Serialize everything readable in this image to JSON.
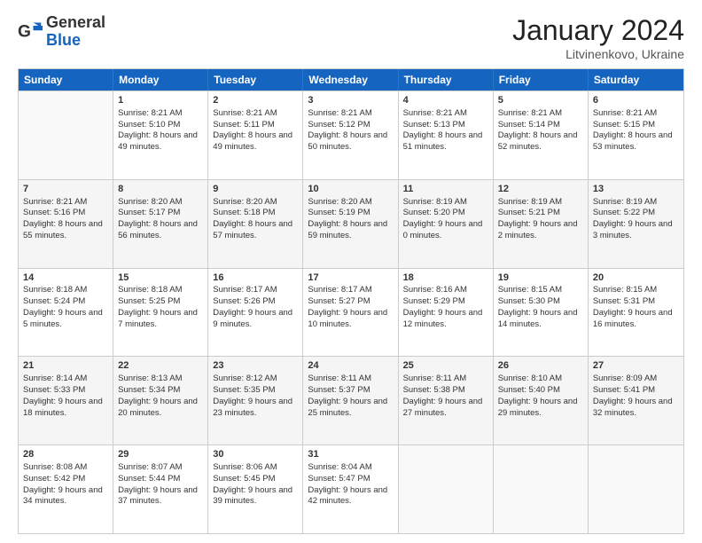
{
  "header": {
    "logo_general": "General",
    "logo_blue": "Blue",
    "month_title": "January 2024",
    "location": "Litvinenkovo, Ukraine"
  },
  "weekdays": [
    "Sunday",
    "Monday",
    "Tuesday",
    "Wednesday",
    "Thursday",
    "Friday",
    "Saturday"
  ],
  "rows": [
    [
      {
        "day": "",
        "sunrise": "",
        "sunset": "",
        "daylight": ""
      },
      {
        "day": "1",
        "sunrise": "Sunrise: 8:21 AM",
        "sunset": "Sunset: 5:10 PM",
        "daylight": "Daylight: 8 hours and 49 minutes."
      },
      {
        "day": "2",
        "sunrise": "Sunrise: 8:21 AM",
        "sunset": "Sunset: 5:11 PM",
        "daylight": "Daylight: 8 hours and 49 minutes."
      },
      {
        "day": "3",
        "sunrise": "Sunrise: 8:21 AM",
        "sunset": "Sunset: 5:12 PM",
        "daylight": "Daylight: 8 hours and 50 minutes."
      },
      {
        "day": "4",
        "sunrise": "Sunrise: 8:21 AM",
        "sunset": "Sunset: 5:13 PM",
        "daylight": "Daylight: 8 hours and 51 minutes."
      },
      {
        "day": "5",
        "sunrise": "Sunrise: 8:21 AM",
        "sunset": "Sunset: 5:14 PM",
        "daylight": "Daylight: 8 hours and 52 minutes."
      },
      {
        "day": "6",
        "sunrise": "Sunrise: 8:21 AM",
        "sunset": "Sunset: 5:15 PM",
        "daylight": "Daylight: 8 hours and 53 minutes."
      }
    ],
    [
      {
        "day": "7",
        "sunrise": "Sunrise: 8:21 AM",
        "sunset": "Sunset: 5:16 PM",
        "daylight": "Daylight: 8 hours and 55 minutes."
      },
      {
        "day": "8",
        "sunrise": "Sunrise: 8:20 AM",
        "sunset": "Sunset: 5:17 PM",
        "daylight": "Daylight: 8 hours and 56 minutes."
      },
      {
        "day": "9",
        "sunrise": "Sunrise: 8:20 AM",
        "sunset": "Sunset: 5:18 PM",
        "daylight": "Daylight: 8 hours and 57 minutes."
      },
      {
        "day": "10",
        "sunrise": "Sunrise: 8:20 AM",
        "sunset": "Sunset: 5:19 PM",
        "daylight": "Daylight: 8 hours and 59 minutes."
      },
      {
        "day": "11",
        "sunrise": "Sunrise: 8:19 AM",
        "sunset": "Sunset: 5:20 PM",
        "daylight": "Daylight: 9 hours and 0 minutes."
      },
      {
        "day": "12",
        "sunrise": "Sunrise: 8:19 AM",
        "sunset": "Sunset: 5:21 PM",
        "daylight": "Daylight: 9 hours and 2 minutes."
      },
      {
        "day": "13",
        "sunrise": "Sunrise: 8:19 AM",
        "sunset": "Sunset: 5:22 PM",
        "daylight": "Daylight: 9 hours and 3 minutes."
      }
    ],
    [
      {
        "day": "14",
        "sunrise": "Sunrise: 8:18 AM",
        "sunset": "Sunset: 5:24 PM",
        "daylight": "Daylight: 9 hours and 5 minutes."
      },
      {
        "day": "15",
        "sunrise": "Sunrise: 8:18 AM",
        "sunset": "Sunset: 5:25 PM",
        "daylight": "Daylight: 9 hours and 7 minutes."
      },
      {
        "day": "16",
        "sunrise": "Sunrise: 8:17 AM",
        "sunset": "Sunset: 5:26 PM",
        "daylight": "Daylight: 9 hours and 9 minutes."
      },
      {
        "day": "17",
        "sunrise": "Sunrise: 8:17 AM",
        "sunset": "Sunset: 5:27 PM",
        "daylight": "Daylight: 9 hours and 10 minutes."
      },
      {
        "day": "18",
        "sunrise": "Sunrise: 8:16 AM",
        "sunset": "Sunset: 5:29 PM",
        "daylight": "Daylight: 9 hours and 12 minutes."
      },
      {
        "day": "19",
        "sunrise": "Sunrise: 8:15 AM",
        "sunset": "Sunset: 5:30 PM",
        "daylight": "Daylight: 9 hours and 14 minutes."
      },
      {
        "day": "20",
        "sunrise": "Sunrise: 8:15 AM",
        "sunset": "Sunset: 5:31 PM",
        "daylight": "Daylight: 9 hours and 16 minutes."
      }
    ],
    [
      {
        "day": "21",
        "sunrise": "Sunrise: 8:14 AM",
        "sunset": "Sunset: 5:33 PM",
        "daylight": "Daylight: 9 hours and 18 minutes."
      },
      {
        "day": "22",
        "sunrise": "Sunrise: 8:13 AM",
        "sunset": "Sunset: 5:34 PM",
        "daylight": "Daylight: 9 hours and 20 minutes."
      },
      {
        "day": "23",
        "sunrise": "Sunrise: 8:12 AM",
        "sunset": "Sunset: 5:35 PM",
        "daylight": "Daylight: 9 hours and 23 minutes."
      },
      {
        "day": "24",
        "sunrise": "Sunrise: 8:11 AM",
        "sunset": "Sunset: 5:37 PM",
        "daylight": "Daylight: 9 hours and 25 minutes."
      },
      {
        "day": "25",
        "sunrise": "Sunrise: 8:11 AM",
        "sunset": "Sunset: 5:38 PM",
        "daylight": "Daylight: 9 hours and 27 minutes."
      },
      {
        "day": "26",
        "sunrise": "Sunrise: 8:10 AM",
        "sunset": "Sunset: 5:40 PM",
        "daylight": "Daylight: 9 hours and 29 minutes."
      },
      {
        "day": "27",
        "sunrise": "Sunrise: 8:09 AM",
        "sunset": "Sunset: 5:41 PM",
        "daylight": "Daylight: 9 hours and 32 minutes."
      }
    ],
    [
      {
        "day": "28",
        "sunrise": "Sunrise: 8:08 AM",
        "sunset": "Sunset: 5:42 PM",
        "daylight": "Daylight: 9 hours and 34 minutes."
      },
      {
        "day": "29",
        "sunrise": "Sunrise: 8:07 AM",
        "sunset": "Sunset: 5:44 PM",
        "daylight": "Daylight: 9 hours and 37 minutes."
      },
      {
        "day": "30",
        "sunrise": "Sunrise: 8:06 AM",
        "sunset": "Sunset: 5:45 PM",
        "daylight": "Daylight: 9 hours and 39 minutes."
      },
      {
        "day": "31",
        "sunrise": "Sunrise: 8:04 AM",
        "sunset": "Sunset: 5:47 PM",
        "daylight": "Daylight: 9 hours and 42 minutes."
      },
      {
        "day": "",
        "sunrise": "",
        "sunset": "",
        "daylight": ""
      },
      {
        "day": "",
        "sunrise": "",
        "sunset": "",
        "daylight": ""
      },
      {
        "day": "",
        "sunrise": "",
        "sunset": "",
        "daylight": ""
      }
    ]
  ]
}
